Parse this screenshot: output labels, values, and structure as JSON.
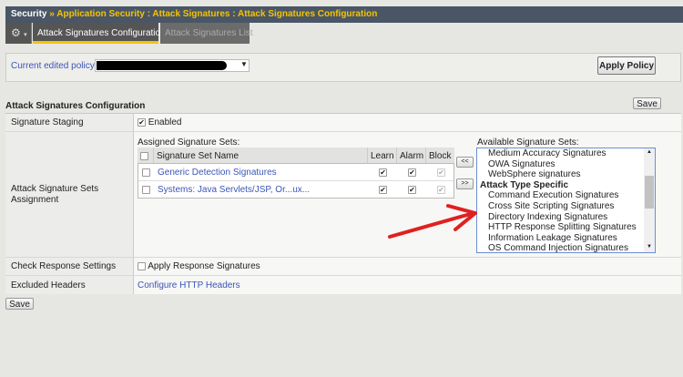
{
  "header": {
    "section": "Security",
    "separator": "»",
    "path": "Application Security : Attack Signatures : Attack Signatures Configuration"
  },
  "tabs": [
    {
      "label": "Attack Signatures Configuration",
      "active": true
    },
    {
      "label": "Attack Signatures List",
      "active": false
    }
  ],
  "policy": {
    "label": "Current edited policy",
    "apply_label": "Apply Policy"
  },
  "section_title": "Attack Signatures Configuration",
  "save_label": "Save",
  "rows": {
    "staging": {
      "label": "Signature Staging",
      "value": "Enabled",
      "checked": true
    },
    "assignment": {
      "label": "Attack Signature Sets Assignment",
      "assigned_title": "Assigned Signature Sets:",
      "available_title": "Available Signature Sets:",
      "columns": [
        "Signature Set Name",
        "Learn",
        "Alarm",
        "Block"
      ],
      "assigned": [
        {
          "name": "Generic Detection Signatures",
          "learn": true,
          "alarm": true,
          "block": true
        },
        {
          "name": "Systems: Java Servlets/JSP, Or...ux...",
          "learn": true,
          "alarm": true,
          "block": true
        }
      ],
      "move_left": "<<",
      "move_right": ">>",
      "available": [
        {
          "text": "Medium Accuracy Signatures",
          "group": false
        },
        {
          "text": "OWA Signatures",
          "group": false
        },
        {
          "text": "WebSphere signatures",
          "group": false
        },
        {
          "text": "Attack Type Specific",
          "group": true
        },
        {
          "text": "Command Execution Signatures",
          "group": false
        },
        {
          "text": "Cross Site Scripting Signatures",
          "group": false
        },
        {
          "text": "Directory Indexing Signatures",
          "group": false
        },
        {
          "text": "HTTP Response Splitting Signatures",
          "group": false
        },
        {
          "text": "Information Leakage Signatures",
          "group": false
        },
        {
          "text": "OS Command Injection Signatures",
          "group": false
        }
      ]
    },
    "check_response": {
      "label": "Check Response Settings",
      "value": "Apply Response Signatures",
      "checked": false
    },
    "excluded": {
      "label": "Excluded Headers",
      "link": "Configure HTTP Headers"
    }
  },
  "colors": {
    "accent": "#f5c400",
    "link": "#3a55b8",
    "annotation": "#e02020"
  }
}
